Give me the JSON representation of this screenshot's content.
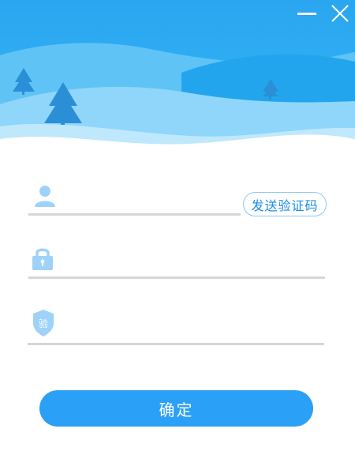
{
  "window": {
    "minimize_icon": "minimize-icon",
    "close_icon": "close-icon"
  },
  "banner": {
    "sky_color": "#2fb0f2",
    "tree_color": "#2a8fd6"
  },
  "form": {
    "username": {
      "icon": "user-icon",
      "value": "",
      "placeholder": ""
    },
    "sms_button_label": "发送验证码",
    "password": {
      "icon": "lock-icon",
      "value": "",
      "placeholder": ""
    },
    "code": {
      "icon": "shield-icon",
      "badge_text": "验",
      "value": "",
      "placeholder": ""
    },
    "confirm_label": "确定"
  },
  "colors": {
    "accent": "#2aa0f6",
    "icon": "#9fd2f8",
    "underline": "#d6d6d6"
  }
}
